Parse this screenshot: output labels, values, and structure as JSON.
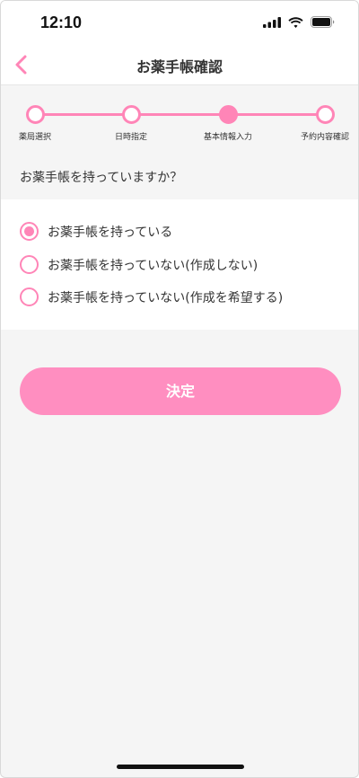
{
  "status": {
    "time": "12:10"
  },
  "header": {
    "title": "お薬手帳確認"
  },
  "stepper": {
    "steps": [
      {
        "label": "薬局選択",
        "active": false
      },
      {
        "label": "日時指定",
        "active": false
      },
      {
        "label": "基本情報入力",
        "active": true
      },
      {
        "label": "予約内容確認",
        "active": false
      }
    ]
  },
  "question": "お薬手帳を持っていますか？",
  "options": [
    {
      "label": "お薬手帳を持っている",
      "checked": true
    },
    {
      "label": "お薬手帳を持っていない(作成しない)",
      "checked": false
    },
    {
      "label": "お薬手帳を持っていない(作成を希望する)",
      "checked": false
    }
  ],
  "submit_label": "決定",
  "colors": {
    "accent": "#ff85b7",
    "button": "#ff8ec0",
    "background": "#f5f5f5"
  }
}
